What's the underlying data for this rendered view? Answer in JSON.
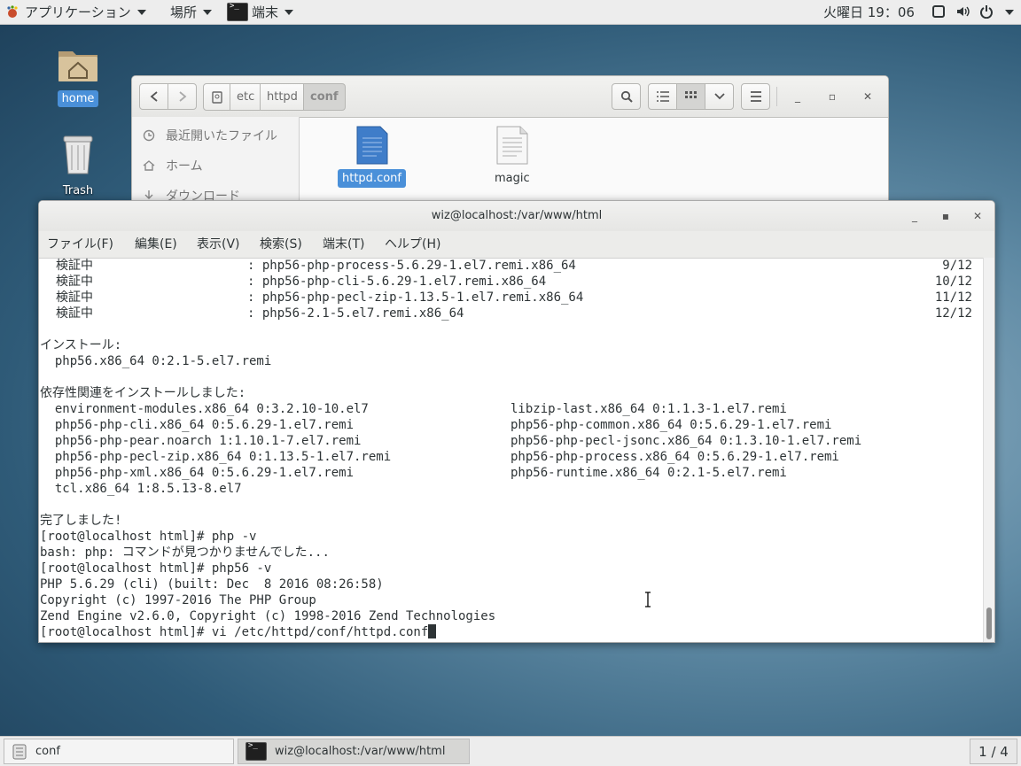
{
  "topbar": {
    "applications": "アプリケーション",
    "places": "場所",
    "active_app": "端末",
    "clock": "火曜日 19：06"
  },
  "desktop": {
    "home_label": "home",
    "trash_label": "Trash"
  },
  "file_manager": {
    "breadcrumb": [
      "etc",
      "httpd",
      "conf"
    ],
    "sidebar": [
      "最近開いたファイル",
      "ホーム",
      "ダウンロード"
    ],
    "files": [
      {
        "name": "httpd.conf",
        "selected": true
      },
      {
        "name": "magic",
        "selected": false
      }
    ]
  },
  "terminal": {
    "title": "wiz@localhost:/var/www/html",
    "menu": [
      "ファイル(F)",
      "編集(E)",
      "表示(V)",
      "検索(S)",
      "端末(T)",
      "ヘルプ(H)"
    ],
    "verify": [
      {
        "label": "検証中",
        "pkg": ": php56-php-process-5.6.29-1.el7.remi.x86_64",
        "count": "9/12"
      },
      {
        "label": "検証中",
        "pkg": ": php56-php-cli-5.6.29-1.el7.remi.x86_64",
        "count": "10/12"
      },
      {
        "label": "検証中",
        "pkg": ": php56-php-pecl-zip-1.13.5-1.el7.remi.x86_64",
        "count": "11/12"
      },
      {
        "label": "検証中",
        "pkg": ": php56-2.1-5.el7.remi.x86_64",
        "count": "12/12"
      }
    ],
    "install_header": "インストール:",
    "install_pkg": "  php56.x86_64 0:2.1-5.el7.remi",
    "deps_header": "依存性関連をインストールしました:",
    "deps_left": [
      "  environment-modules.x86_64 0:3.2.10-10.el7",
      "  php56-php-cli.x86_64 0:5.6.29-1.el7.remi",
      "  php56-php-pear.noarch 1:1.10.1-7.el7.remi",
      "  php56-php-pecl-zip.x86_64 0:1.13.5-1.el7.remi",
      "  php56-php-xml.x86_64 0:5.6.29-1.el7.remi",
      "  tcl.x86_64 1:8.5.13-8.el7"
    ],
    "deps_right": [
      "libzip-last.x86_64 0:1.1.3-1.el7.remi",
      "php56-php-common.x86_64 0:5.6.29-1.el7.remi",
      "php56-php-pecl-jsonc.x86_64 0:1.3.10-1.el7.remi",
      "php56-php-process.x86_64 0:5.6.29-1.el7.remi",
      "php56-runtime.x86_64 0:2.1-5.el7.remi"
    ],
    "done": "完了しました!",
    "tail": [
      "[root@localhost html]# php -v",
      "bash: php: コマンドが見つかりませんでした...",
      "[root@localhost html]# php56 -v",
      "PHP 5.6.29 (cli) (built: Dec  8 2016 08:26:58)",
      "Copyright (c) 1997-2016 The PHP Group",
      "Zend Engine v2.6.0, Copyright (c) 1998-2016 Zend Technologies"
    ],
    "prompt": "[root@localhost html]# vi /etc/httpd/conf/httpd.conf"
  },
  "taskbar": {
    "tasks": [
      "conf",
      "wiz@localhost:/var/www/html"
    ],
    "workspace": "1 / 4"
  }
}
